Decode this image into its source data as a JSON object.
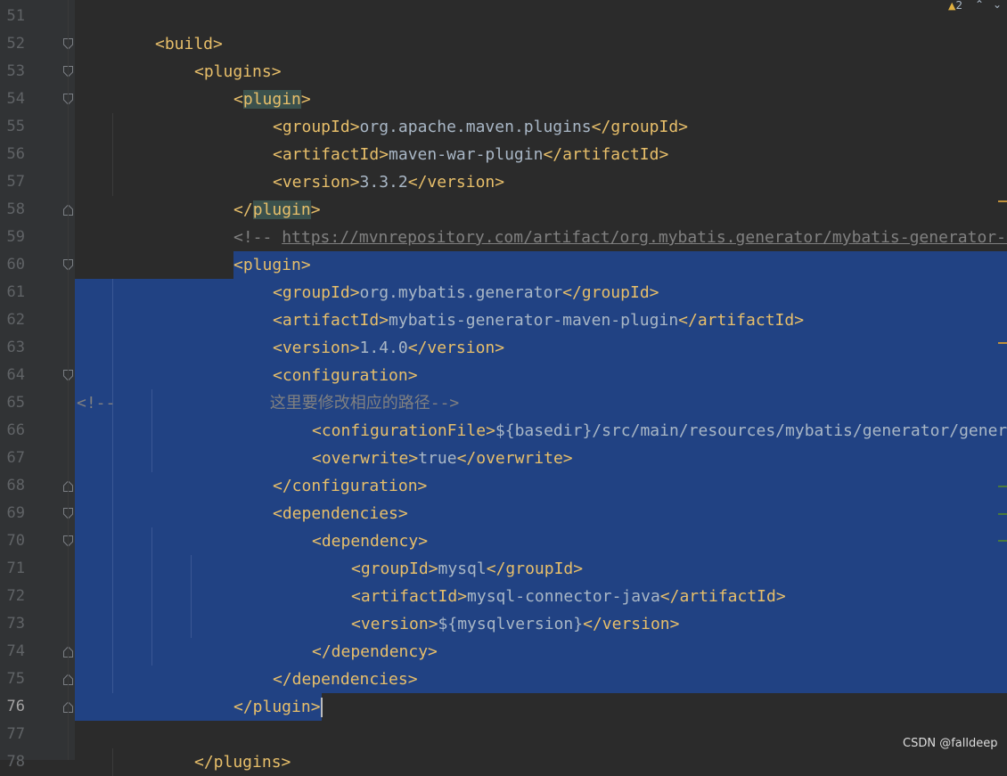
{
  "editor": {
    "current_line": 76,
    "warnings": {
      "count": "2"
    },
    "lines": [
      {
        "num": "51"
      },
      {
        "num": "52",
        "fold": "open",
        "tokens": [
          {
            "t": "<build>",
            "c": "tg"
          }
        ]
      },
      {
        "num": "53",
        "fold": "open",
        "tokens": [
          {
            "t": "<plugins>",
            "c": "tg"
          }
        ]
      },
      {
        "num": "54",
        "fold": "open",
        "tokens": [
          {
            "t": "<",
            "c": "tg"
          },
          {
            "t": "plugin",
            "c": "tg brhl"
          },
          {
            "t": ">",
            "c": "tg"
          }
        ]
      },
      {
        "num": "55",
        "tokens": [
          {
            "t": "<groupId>",
            "c": "tg"
          },
          {
            "t": "org.apache.maven.plugins",
            "c": "tx"
          },
          {
            "t": "</groupId>",
            "c": "tg"
          }
        ]
      },
      {
        "num": "56",
        "tokens": [
          {
            "t": "<artifactId>",
            "c": "tg"
          },
          {
            "t": "maven-war-plugin",
            "c": "tx"
          },
          {
            "t": "</artifactId>",
            "c": "tg"
          }
        ]
      },
      {
        "num": "57",
        "tokens": [
          {
            "t": "<version>",
            "c": "tg"
          },
          {
            "t": "3.3.2",
            "c": "tx"
          },
          {
            "t": "</version>",
            "c": "tg"
          }
        ]
      },
      {
        "num": "58",
        "fold": "close",
        "tokens": [
          {
            "t": "</",
            "c": "tg"
          },
          {
            "t": "plugin",
            "c": "tg brhl"
          },
          {
            "t": ">",
            "c": "tg"
          }
        ]
      },
      {
        "num": "59",
        "tokens": [
          {
            "t": "<!-- ",
            "c": "cm"
          },
          {
            "t": "https://mvnrepository.com/artifact/org.mybatis.generator/mybatis-generator-maven-plugin",
            "c": "url"
          }
        ]
      },
      {
        "num": "60",
        "fold": "open",
        "tokens": [
          {
            "t": "<plugin>",
            "c": "tg"
          }
        ]
      },
      {
        "num": "61",
        "tokens": [
          {
            "t": "<groupId>",
            "c": "tg"
          },
          {
            "t": "org.mybatis.generator",
            "c": "tx"
          },
          {
            "t": "</groupId>",
            "c": "tg"
          }
        ]
      },
      {
        "num": "62",
        "tokens": [
          {
            "t": "<artifactId>",
            "c": "tg"
          },
          {
            "t": "mybatis-generator-maven-plugin",
            "c": "tx"
          },
          {
            "t": "</artifactId>",
            "c": "tg"
          }
        ]
      },
      {
        "num": "63",
        "tokens": [
          {
            "t": "<version>",
            "c": "tg"
          },
          {
            "t": "1.4.0",
            "c": "tx"
          },
          {
            "t": "</version>",
            "c": "tg"
          }
        ]
      },
      {
        "num": "64",
        "fold": "open",
        "tokens": [
          {
            "t": "<configuration>",
            "c": "tg"
          }
        ]
      },
      {
        "num": "65",
        "tokens": [
          {
            "t": "<!--",
            "c": "cm"
          },
          {
            "t": "                这里要修改相应的路径-->",
            "c": "cm"
          }
        ]
      },
      {
        "num": "66",
        "tokens": [
          {
            "t": "<configurationFile>",
            "c": "tg"
          },
          {
            "t": "${basedir}/src/main/resources/mybatis/generator/generatorConfig.xml",
            "c": "tx"
          }
        ]
      },
      {
        "num": "67",
        "tokens": [
          {
            "t": "<overwrite>",
            "c": "tg"
          },
          {
            "t": "true",
            "c": "tx"
          },
          {
            "t": "</overwrite>",
            "c": "tg"
          }
        ]
      },
      {
        "num": "68",
        "fold": "close",
        "tokens": [
          {
            "t": "</configuration>",
            "c": "tg"
          }
        ]
      },
      {
        "num": "69",
        "fold": "open",
        "tokens": [
          {
            "t": "<dependencies>",
            "c": "tg"
          }
        ]
      },
      {
        "num": "70",
        "fold": "open",
        "tokens": [
          {
            "t": "<dependency>",
            "c": "tg"
          }
        ]
      },
      {
        "num": "71",
        "tokens": [
          {
            "t": "<groupId>",
            "c": "tg"
          },
          {
            "t": "mysql",
            "c": "tx"
          },
          {
            "t": "</groupId>",
            "c": "tg"
          }
        ]
      },
      {
        "num": "72",
        "tokens": [
          {
            "t": "<artifactId>",
            "c": "tg"
          },
          {
            "t": "mysql-connector-java",
            "c": "tx"
          },
          {
            "t": "</artifactId>",
            "c": "tg"
          }
        ]
      },
      {
        "num": "73",
        "tokens": [
          {
            "t": "<version>",
            "c": "tg"
          },
          {
            "t": "${mysqlversion}",
            "c": "tx"
          },
          {
            "t": "</version>",
            "c": "tg"
          }
        ]
      },
      {
        "num": "74",
        "fold": "close",
        "tokens": [
          {
            "t": "</dependency>",
            "c": "tg"
          }
        ]
      },
      {
        "num": "75",
        "fold": "close",
        "tokens": [
          {
            "t": "</dependencies>",
            "c": "tg"
          }
        ]
      },
      {
        "num": "76",
        "fold": "close",
        "bulb": true,
        "tokens": [
          {
            "t": "</plugin>",
            "c": "tg"
          }
        ],
        "caret": true
      },
      {
        "num": "77"
      },
      {
        "num": "78",
        "tokens": [
          {
            "t": "</plugins>",
            "c": "tg"
          }
        ]
      }
    ]
  },
  "colors": {
    "background": "#2b2b2b",
    "gutter": "#313335",
    "selection": "#214283",
    "tag": "#e8bf6a",
    "text": "#a9b7c6",
    "comment": "#808080"
  },
  "icons": {
    "fold_open": "fold-open-icon",
    "fold_close": "fold-close-icon",
    "bulb": "lightbulb-icon",
    "warning": "warning-icon"
  },
  "watermark": "CSDN @falldeep"
}
